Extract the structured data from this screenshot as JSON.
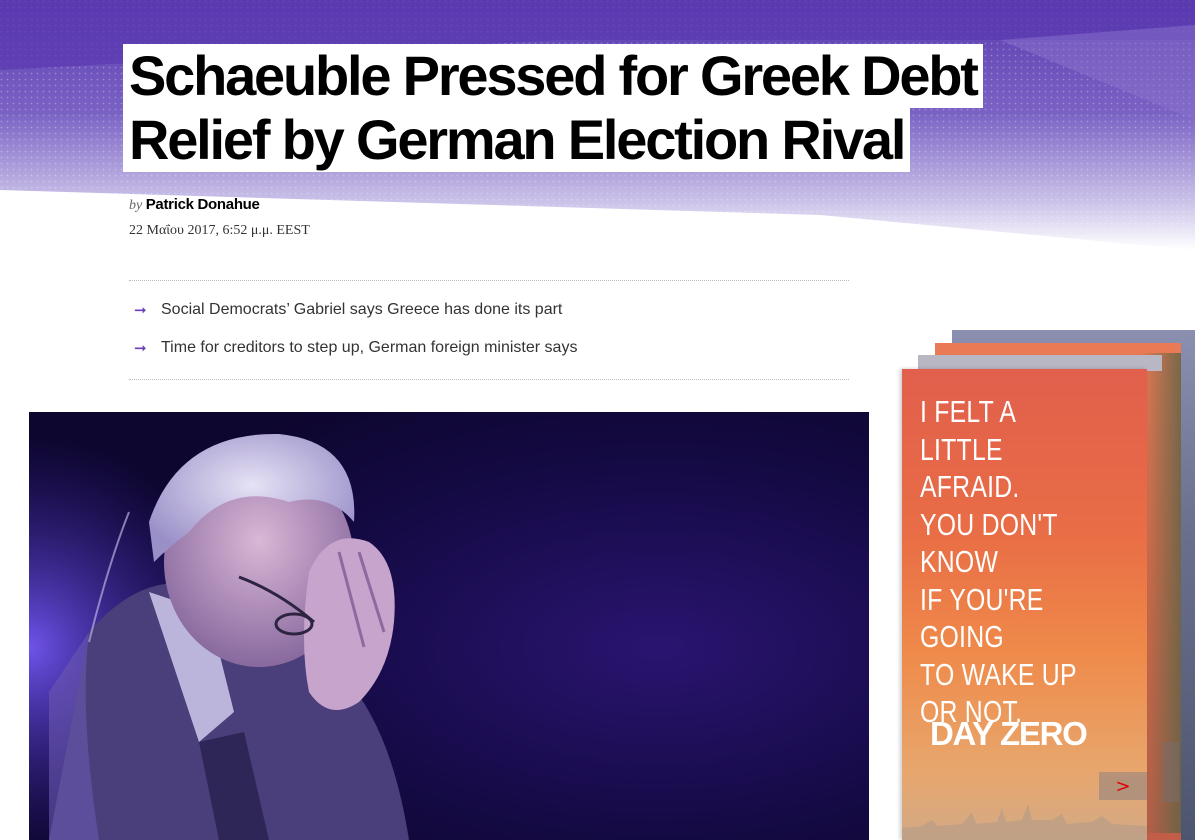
{
  "article": {
    "headline_line1": "Schaeuble Pressed for Greek Debt",
    "headline_line2": "Relief by German Election Rival",
    "by_label": "by",
    "author": "Patrick Donahue",
    "date": "22 Μαΐου 2017, 6:52 μ.μ. EEST",
    "summary": [
      "Social Democrats’ Gabriel says Greece has done its part",
      "Time for creditors to step up, German foreign minister says"
    ],
    "arrow_glyph": "➞"
  },
  "ad": {
    "text": "I FELT A LITTLE AFRAID. YOU DON'T KNOW IF YOU'RE GOING TO WAKE UP OR NOT.",
    "lines": [
      "I FELT A",
      "LITTLE AFRAID.",
      "YOU DON'T KNOW",
      "IF YOU'RE GOING",
      "TO WAKE UP",
      "OR NOT."
    ],
    "logo": "DAY ZERO",
    "next_glyph": ">"
  },
  "colors": {
    "accent_purple": "#6a3fb6",
    "band_purple": "#5b3ab0",
    "ad_orange": "#e96d46"
  }
}
